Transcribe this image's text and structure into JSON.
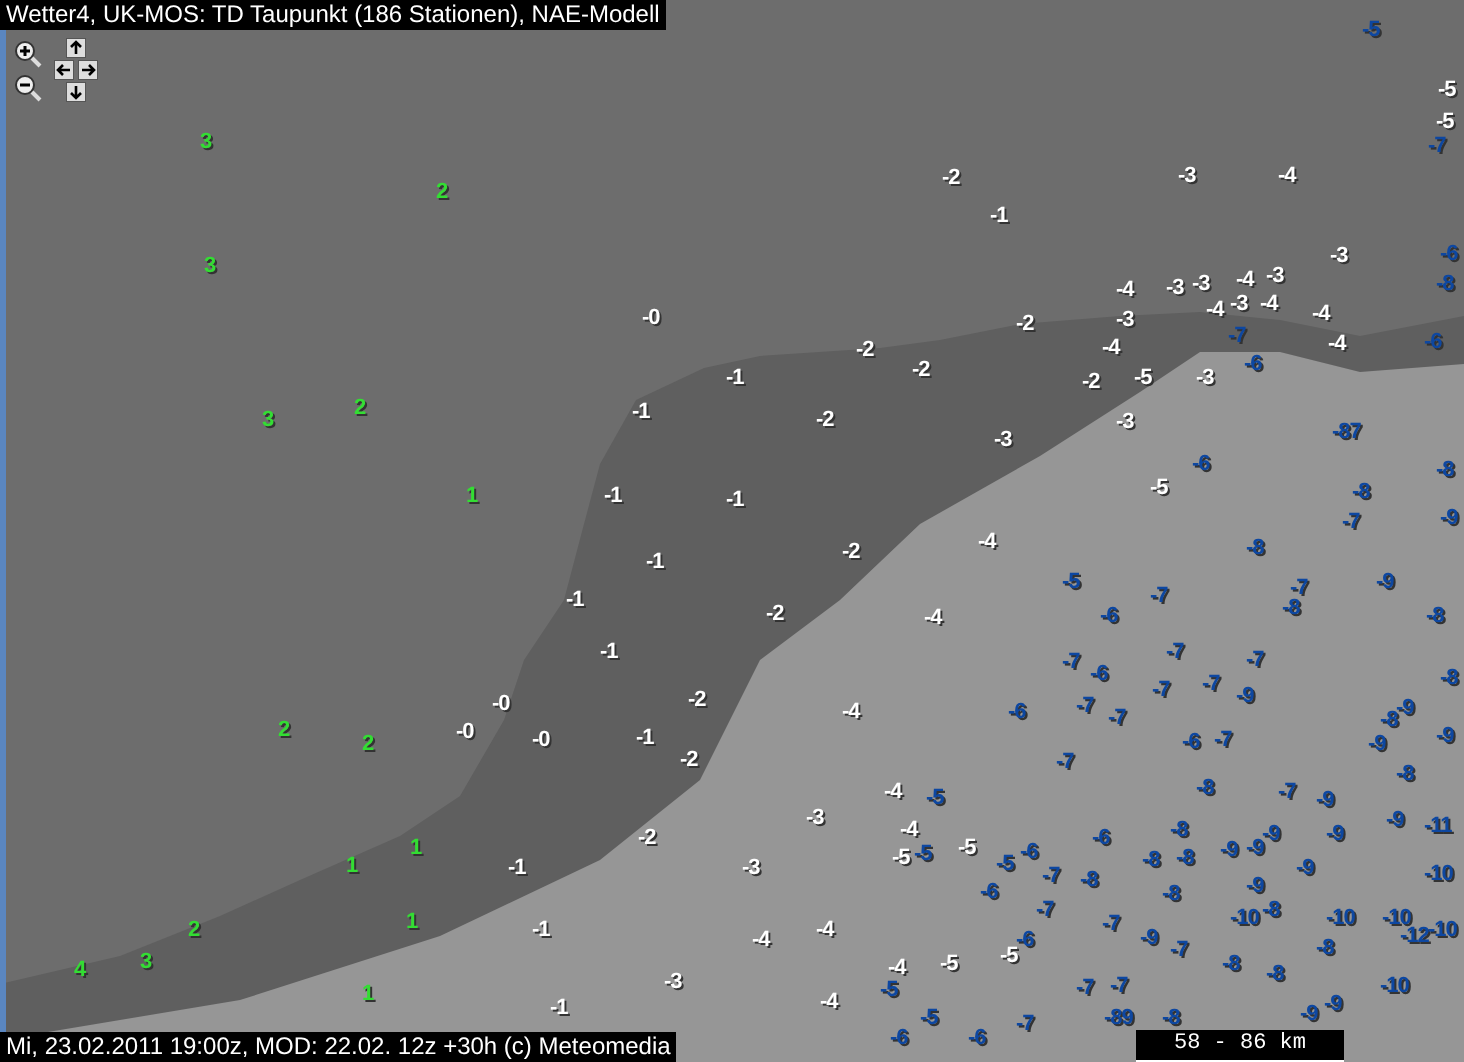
{
  "title": "Wetter4, UK-MOS: TD Taupunkt (186 Stationen), NAE-Modell",
  "stations": [
    {
      "value": "-5",
      "color": "#0d47a1"
    },
    {
      "value": "-5",
      "color": "#ffffff"
    },
    {
      "value": "-5",
      "color": "#ffffff"
    },
    {
      "value": "3",
      "color": "#33dd33"
    },
    {
      "value": "-7",
      "color": "#0d47a1"
    },
    {
      "value": "2",
      "color": "#33dd33"
    },
    {
      "value": "-2",
      "color": "#ffffff"
    },
    {
      "value": "-3",
      "color": "#ffffff"
    },
    {
      "value": "-4",
      "color": "#ffffff"
    },
    {
      "value": "-1",
      "color": "#ffffff"
    },
    {
      "value": "3",
      "color": "#33dd33"
    },
    {
      "value": "-3",
      "color": "#ffffff"
    },
    {
      "value": "-6",
      "color": "#0d47a1"
    },
    {
      "value": "-4",
      "color": "#ffffff"
    },
    {
      "value": "-3",
      "color": "#ffffff"
    },
    {
      "value": "-3",
      "color": "#ffffff"
    },
    {
      "value": "-4",
      "color": "#ffffff"
    },
    {
      "value": "-3",
      "color": "#ffffff"
    },
    {
      "value": "-8",
      "color": "#0d47a1"
    },
    {
      "value": "-4",
      "color": "#ffffff"
    },
    {
      "value": "-3",
      "color": "#ffffff"
    },
    {
      "value": "-4",
      "color": "#ffffff"
    },
    {
      "value": "-0",
      "color": "#ffffff"
    },
    {
      "value": "-2",
      "color": "#ffffff"
    },
    {
      "value": "-3",
      "color": "#ffffff"
    },
    {
      "value": "-4",
      "color": "#ffffff"
    },
    {
      "value": "-2",
      "color": "#ffffff"
    },
    {
      "value": "-4",
      "color": "#ffffff"
    },
    {
      "value": "-7",
      "color": "#0d47a1"
    },
    {
      "value": "-4",
      "color": "#ffffff"
    },
    {
      "value": "-6",
      "color": "#0d47a1"
    },
    {
      "value": "-1",
      "color": "#ffffff"
    },
    {
      "value": "-2",
      "color": "#ffffff"
    },
    {
      "value": "-2",
      "color": "#ffffff"
    },
    {
      "value": "-5",
      "color": "#ffffff"
    },
    {
      "value": "-3",
      "color": "#ffffff"
    },
    {
      "value": "-6",
      "color": "#0d47a1"
    },
    {
      "value": "3",
      "color": "#33dd33"
    },
    {
      "value": "2",
      "color": "#33dd33"
    },
    {
      "value": "-1",
      "color": "#ffffff"
    },
    {
      "value": "-2",
      "color": "#ffffff"
    },
    {
      "value": "-3",
      "color": "#ffffff"
    },
    {
      "value": "-3",
      "color": "#ffffff"
    },
    {
      "value": "-87",
      "color": "#0d47a1"
    },
    {
      "value": "-6",
      "color": "#0d47a1"
    },
    {
      "value": "-8",
      "color": "#0d47a1"
    },
    {
      "value": "1",
      "color": "#33dd33"
    },
    {
      "value": "-1",
      "color": "#ffffff"
    },
    {
      "value": "-1",
      "color": "#ffffff"
    },
    {
      "value": "-5",
      "color": "#ffffff"
    },
    {
      "value": "-8",
      "color": "#0d47a1"
    },
    {
      "value": "-7",
      "color": "#0d47a1"
    },
    {
      "value": "-9",
      "color": "#0d47a1"
    },
    {
      "value": "-1",
      "color": "#ffffff"
    },
    {
      "value": "-2",
      "color": "#ffffff"
    },
    {
      "value": "-4",
      "color": "#ffffff"
    },
    {
      "value": "-8",
      "color": "#0d47a1"
    },
    {
      "value": "-1",
      "color": "#ffffff"
    },
    {
      "value": "-5",
      "color": "#0d47a1"
    },
    {
      "value": "-7",
      "color": "#0d47a1"
    },
    {
      "value": "-7",
      "color": "#0d47a1"
    },
    {
      "value": "-9",
      "color": "#0d47a1"
    },
    {
      "value": "-2",
      "color": "#ffffff"
    },
    {
      "value": "-4",
      "color": "#ffffff"
    },
    {
      "value": "-6",
      "color": "#0d47a1"
    },
    {
      "value": "-8",
      "color": "#0d47a1"
    },
    {
      "value": "-8",
      "color": "#0d47a1"
    },
    {
      "value": "-1",
      "color": "#ffffff"
    },
    {
      "value": "-7",
      "color": "#0d47a1"
    },
    {
      "value": "-6",
      "color": "#0d47a1"
    },
    {
      "value": "-7",
      "color": "#0d47a1"
    },
    {
      "value": "-7",
      "color": "#0d47a1"
    },
    {
      "value": "-8",
      "color": "#0d47a1"
    },
    {
      "value": "-7",
      "color": "#0d47a1"
    },
    {
      "value": "-7",
      "color": "#0d47a1"
    },
    {
      "value": "-9",
      "color": "#0d47a1"
    },
    {
      "value": "-0",
      "color": "#ffffff"
    },
    {
      "value": "-2",
      "color": "#ffffff"
    },
    {
      "value": "-4",
      "color": "#ffffff"
    },
    {
      "value": "-6",
      "color": "#0d47a1"
    },
    {
      "value": "-7",
      "color": "#0d47a1"
    },
    {
      "value": "-7",
      "color": "#0d47a1"
    },
    {
      "value": "-8",
      "color": "#0d47a1"
    },
    {
      "value": "-9",
      "color": "#0d47a1"
    },
    {
      "value": "2",
      "color": "#33dd33"
    },
    {
      "value": "2",
      "color": "#33dd33"
    },
    {
      "value": "-0",
      "color": "#ffffff"
    },
    {
      "value": "-0",
      "color": "#ffffff"
    },
    {
      "value": "-1",
      "color": "#ffffff"
    },
    {
      "value": "-6",
      "color": "#0d47a1"
    },
    {
      "value": "-7",
      "color": "#0d47a1"
    },
    {
      "value": "-9",
      "color": "#0d47a1"
    },
    {
      "value": "-9",
      "color": "#0d47a1"
    },
    {
      "value": "-2",
      "color": "#ffffff"
    },
    {
      "value": "-7",
      "color": "#0d47a1"
    },
    {
      "value": "-8",
      "color": "#0d47a1"
    },
    {
      "value": "-4",
      "color": "#ffffff"
    },
    {
      "value": "-5",
      "color": "#0d47a1"
    },
    {
      "value": "-8",
      "color": "#0d47a1"
    },
    {
      "value": "-7",
      "color": "#0d47a1"
    },
    {
      "value": "-9",
      "color": "#0d47a1"
    },
    {
      "value": "-2",
      "color": "#ffffff"
    },
    {
      "value": "-3",
      "color": "#ffffff"
    },
    {
      "value": "-4",
      "color": "#ffffff"
    },
    {
      "value": "-6",
      "color": "#0d47a1"
    },
    {
      "value": "-8",
      "color": "#0d47a1"
    },
    {
      "value": "-9",
      "color": "#0d47a1"
    },
    {
      "value": "-9",
      "color": "#0d47a1"
    },
    {
      "value": "-9",
      "color": "#0d47a1"
    },
    {
      "value": "-11",
      "color": "#0d47a1"
    },
    {
      "value": "1",
      "color": "#33dd33"
    },
    {
      "value": "1",
      "color": "#33dd33"
    },
    {
      "value": "-1",
      "color": "#ffffff"
    },
    {
      "value": "-3",
      "color": "#ffffff"
    },
    {
      "value": "-5",
      "color": "#ffffff"
    },
    {
      "value": "-5",
      "color": "#0d47a1"
    },
    {
      "value": "-5",
      "color": "#ffffff"
    },
    {
      "value": "-5",
      "color": "#0d47a1"
    },
    {
      "value": "-6",
      "color": "#0d47a1"
    },
    {
      "value": "-8",
      "color": "#0d47a1"
    },
    {
      "value": "-8",
      "color": "#0d47a1"
    },
    {
      "value": "-9",
      "color": "#0d47a1"
    },
    {
      "value": "-9",
      "color": "#0d47a1"
    },
    {
      "value": "-9",
      "color": "#0d47a1"
    },
    {
      "value": "-6",
      "color": "#0d47a1"
    },
    {
      "value": "-7",
      "color": "#0d47a1"
    },
    {
      "value": "-8",
      "color": "#0d47a1"
    },
    {
      "value": "-8",
      "color": "#0d47a1"
    },
    {
      "value": "-9",
      "color": "#0d47a1"
    },
    {
      "value": "-10",
      "color": "#0d47a1"
    },
    {
      "value": "1",
      "color": "#33dd33"
    },
    {
      "value": "-7",
      "color": "#0d47a1"
    },
    {
      "value": "-7",
      "color": "#0d47a1"
    },
    {
      "value": "-10",
      "color": "#0d47a1"
    },
    {
      "value": "-8",
      "color": "#0d47a1"
    },
    {
      "value": "-10",
      "color": "#0d47a1"
    },
    {
      "value": "-10",
      "color": "#0d47a1"
    },
    {
      "value": "2",
      "color": "#33dd33"
    },
    {
      "value": "-1",
      "color": "#ffffff"
    },
    {
      "value": "-4",
      "color": "#ffffff"
    },
    {
      "value": "-4",
      "color": "#ffffff"
    },
    {
      "value": "-6",
      "color": "#0d47a1"
    },
    {
      "value": "-9",
      "color": "#0d47a1"
    },
    {
      "value": "-7",
      "color": "#0d47a1"
    },
    {
      "value": "-8",
      "color": "#0d47a1"
    },
    {
      "value": "-12",
      "color": "#0d47a1"
    },
    {
      "value": "-10",
      "color": "#0d47a1"
    },
    {
      "value": "4",
      "color": "#33dd33"
    },
    {
      "value": "3",
      "color": "#33dd33"
    },
    {
      "value": "-4",
      "color": "#ffffff"
    },
    {
      "value": "-5",
      "color": "#ffffff"
    },
    {
      "value": "-5",
      "color": "#ffffff"
    },
    {
      "value": "-8",
      "color": "#0d47a1"
    },
    {
      "value": "-8",
      "color": "#0d47a1"
    },
    {
      "value": "1",
      "color": "#33dd33"
    },
    {
      "value": "-3",
      "color": "#ffffff"
    },
    {
      "value": "-5",
      "color": "#0d47a1"
    },
    {
      "value": "-7",
      "color": "#0d47a1"
    },
    {
      "value": "-7",
      "color": "#0d47a1"
    },
    {
      "value": "-10",
      "color": "#0d47a1"
    },
    {
      "value": "-1",
      "color": "#ffffff"
    },
    {
      "value": "-4",
      "color": "#ffffff"
    },
    {
      "value": "-5",
      "color": "#0d47a1"
    },
    {
      "value": "-7",
      "color": "#0d47a1"
    },
    {
      "value": "-89",
      "color": "#0d47a1"
    },
    {
      "value": "-8",
      "color": "#0d47a1"
    },
    {
      "value": "-9",
      "color": "#0d47a1"
    },
    {
      "value": "-9",
      "color": "#0d47a1"
    },
    {
      "value": "-6",
      "color": "#0d47a1"
    },
    {
      "value": "-6",
      "color": "#0d47a1"
    }
  ],
  "footer": "Mi, 23.02.2011 19:00z, MOD: 22.02. 12z +30h (c) Meteomedia",
  "scale": "58 - 86 km"
}
